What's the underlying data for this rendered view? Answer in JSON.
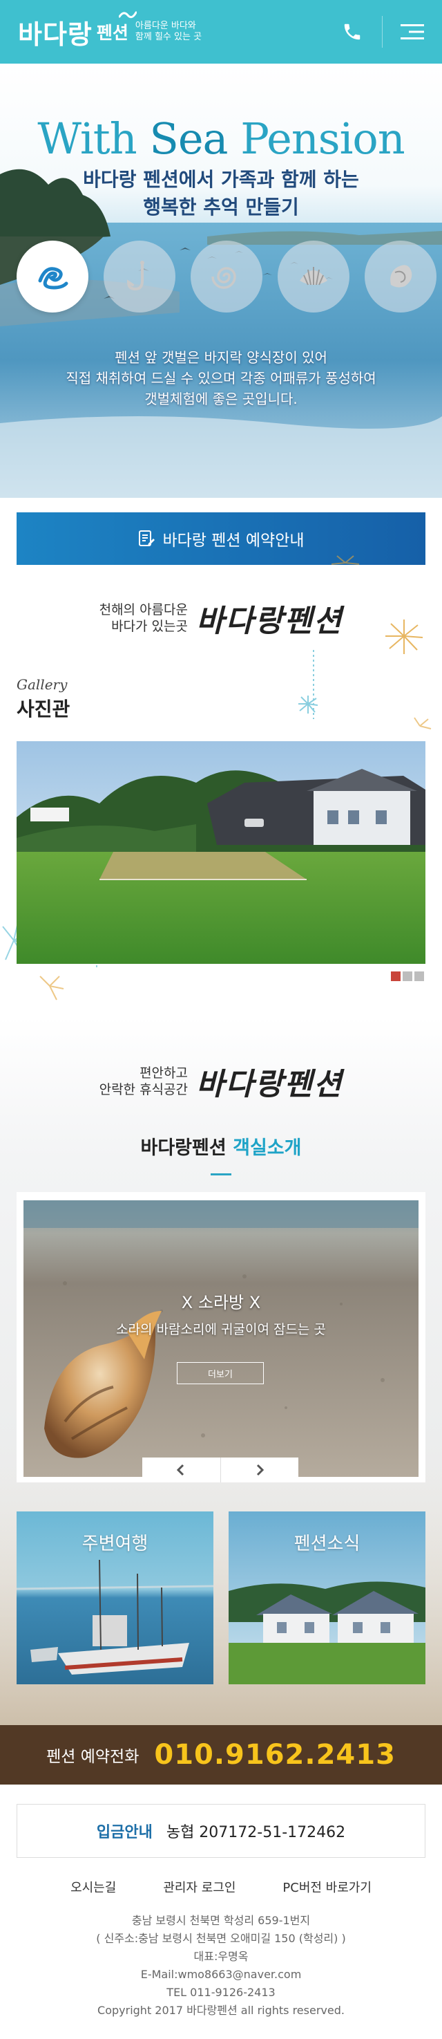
{
  "header": {
    "logo_main": "바다랑",
    "logo_sub": "펜션",
    "logo_tag_line1": "아름다운 바다와",
    "logo_tag_line2": "함께 힐수 있는 곳",
    "phone_icon": "phone-icon",
    "menu_icon": "menu-icon"
  },
  "hero": {
    "title_part1": "With ",
    "title_part2": "Sea",
    "title_part3": " Pension",
    "subtitle_line1": "바다랑 펜션에서 가족과 함께 하는",
    "subtitle_line2": "행복한 추억 만들기",
    "icons": [
      "wave-icon",
      "fishhook-icon",
      "snail-icon",
      "clam-icon",
      "shell-icon"
    ],
    "desc_line1": "펜션 앞 갯벌은 바지락 양식장이 있어",
    "desc_line2": "직접 채취하여 드실 수 있으며 각종 어패류가 풍성하여",
    "desc_line3": "갯벌체험에 좋은 곳입니다."
  },
  "reserve": {
    "label": "바다랑 펜션 예약안내"
  },
  "intro1": {
    "line1": "천해의 아름다운",
    "line2": "바다가 있는곳",
    "brand": "바다랑펜션"
  },
  "gallery": {
    "title_en": "Gallery",
    "title_ko": "사진관",
    "dots": 3,
    "active_dot": 0
  },
  "intro2": {
    "line1": "편안하고",
    "line2": "안락한 휴식공간",
    "brand": "바다랑펜션"
  },
  "rooms": {
    "title_main": "바다랑펜션 ",
    "title_hl": "객실소개",
    "room_name": "X 소라방 X",
    "room_desc": "소라의 바람소리에 귀굴이여 잠드는 곳",
    "more": "더보기"
  },
  "tiles": [
    {
      "label": "주변여행"
    },
    {
      "label": "펜션소식"
    }
  ],
  "phone_bar": {
    "label": "펜션 예약전화",
    "number": "010.9162.2413"
  },
  "bank": {
    "label": "입금안내",
    "info": "농협 207172-51-172462"
  },
  "footer": {
    "links": [
      "오시는길",
      "관리자 로그인",
      "PC버전 바로가기"
    ],
    "address": "충남 보령시 천북면 학성리 659-1번지",
    "new_address": "( 신주소:충남 보령시 천북면 오애미길 150 (학성리) )",
    "ceo": "대표:우명옥",
    "email": "E-Mail:wmo8663@naver.com",
    "tel": "TEL 011-9126-2413",
    "copyright": "Copyright 2017 바다랑펜션 all rights reserved."
  },
  "colors": {
    "header": "#3fc0cf",
    "reserve": "#1d6fa8",
    "phone_bar": "#523925",
    "phone_number": "#f8c41c",
    "accent": "#1ea3c7"
  }
}
